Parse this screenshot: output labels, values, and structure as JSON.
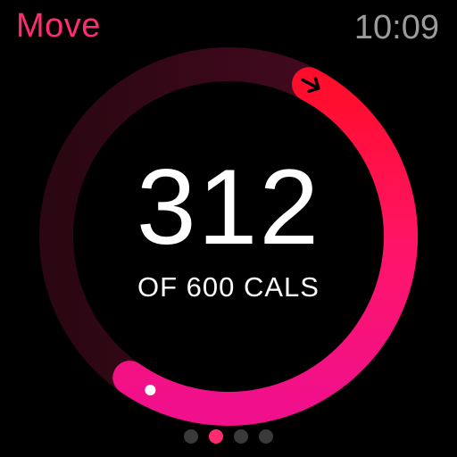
{
  "header": {
    "title": "Move",
    "time": "10:09"
  },
  "activity": {
    "value": "312",
    "goal_label": "OF 600 CALS",
    "progress_fraction": 0.52
  },
  "colors": {
    "accent": "#ff2d6f",
    "ring_start": "#e8108f",
    "ring_end": "#ff1a3a",
    "ring_track": "#3a0a1c",
    "time_gray": "#9c9c9c"
  },
  "icons": {
    "ring_head": "arrow-right-icon",
    "ring_start": "dot-icon"
  },
  "pagination": {
    "count": 4,
    "active_index": 1
  }
}
